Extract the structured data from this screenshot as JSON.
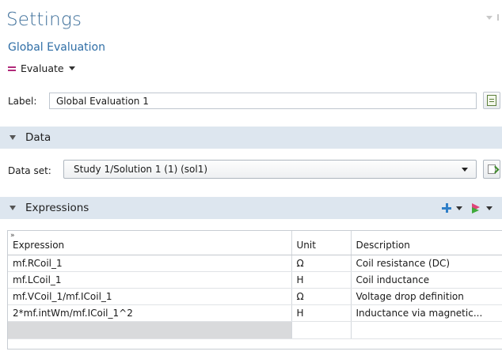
{
  "header": {
    "title": "Settings",
    "subtitle": "Global Evaluation",
    "evaluate_label": "Evaluate"
  },
  "label_row": {
    "label": "Label:",
    "value": "Global Evaluation 1"
  },
  "sections": {
    "data": "Data",
    "expressions": "Expressions"
  },
  "data_set": {
    "label": "Data set:",
    "selected": "Study 1/Solution 1 (1) (sol1)"
  },
  "table": {
    "headers": [
      "Expression",
      "Unit",
      "Description"
    ],
    "rows": [
      {
        "expression": "mf.RCoil_1",
        "unit": "Ω",
        "description": "Coil resistance (DC)"
      },
      {
        "expression": "mf.LCoil_1",
        "unit": "H",
        "description": "Coil inductance"
      },
      {
        "expression": "mf.VCoil_1/mf.ICoil_1",
        "unit": "Ω",
        "description": "Voltage drop definition"
      },
      {
        "expression": "2*mf.intWm/mf.ICoil_1^2",
        "unit": "H",
        "description": "Inductance via magnetic..."
      }
    ]
  },
  "icons": {
    "evaluate": "evaluate-icon",
    "label_action": "document-icon",
    "dataset_action": "dataset-refresh-icon",
    "add": "add-icon",
    "flag": "flag-icon"
  }
}
